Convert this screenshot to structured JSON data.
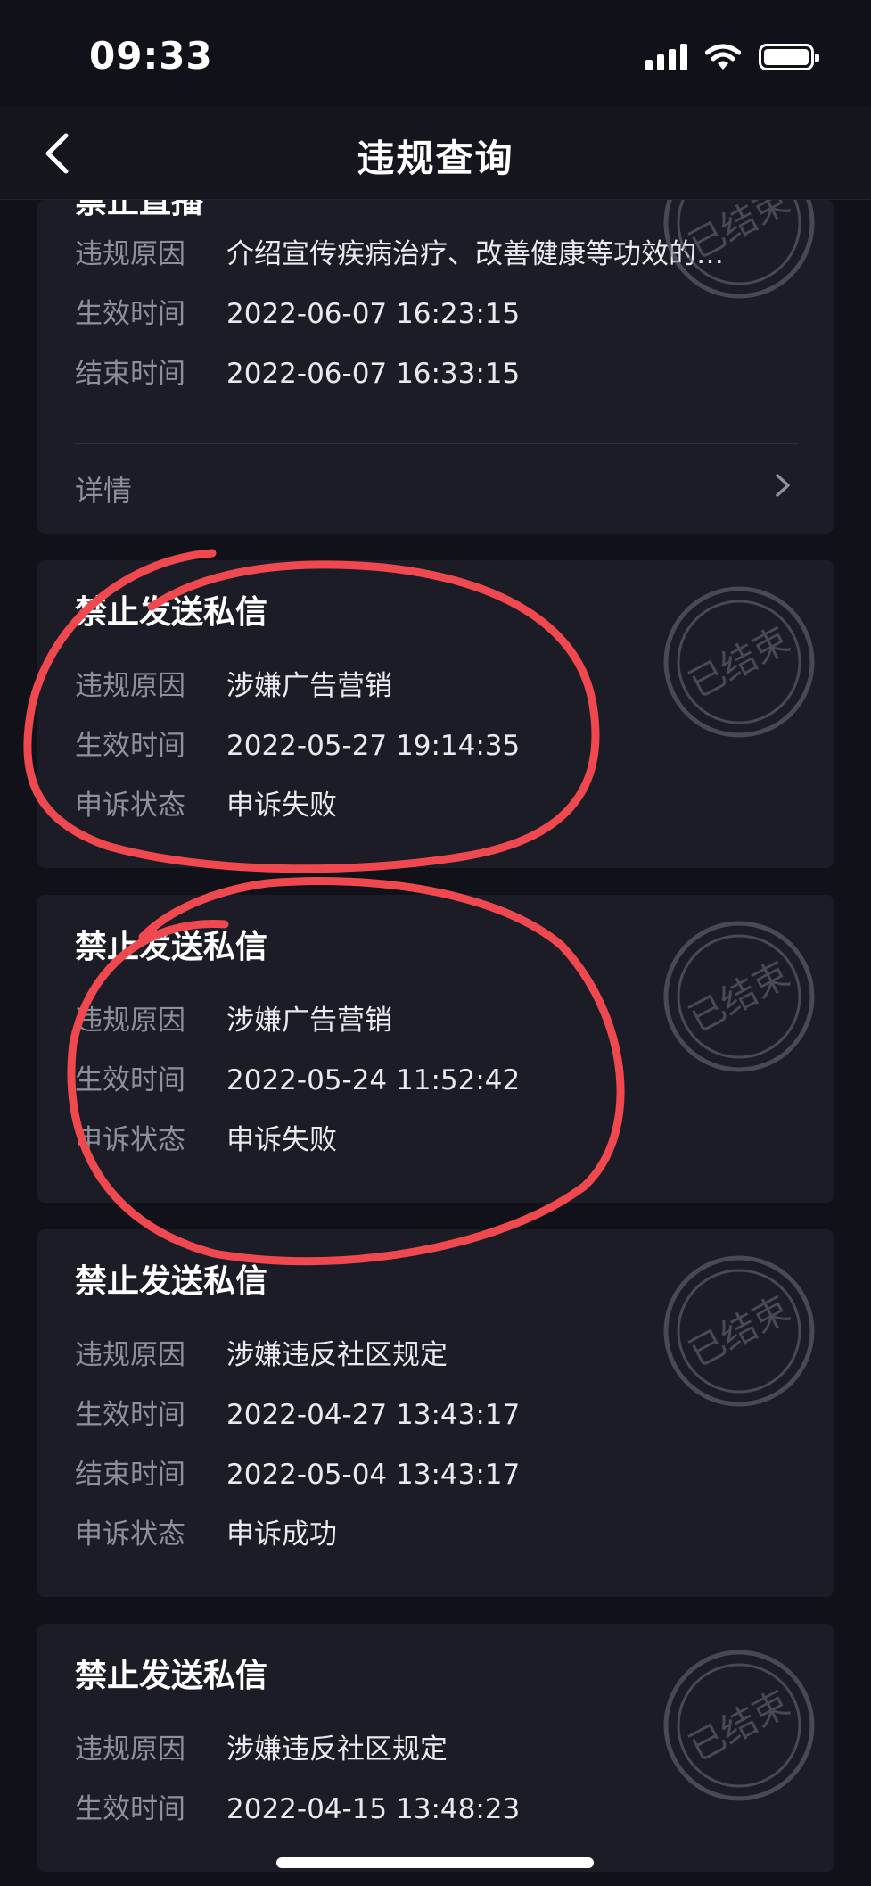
{
  "status_bar": {
    "time": "09:33"
  },
  "nav": {
    "title": "违规查询"
  },
  "labels": {
    "reason": "违规原因",
    "effective": "生效时间",
    "end": "结束时间",
    "appeal": "申诉状态",
    "details": "详情"
  },
  "stamp_text": "已结束",
  "records": [
    {
      "title": "禁止直播",
      "reason": "介绍宣传疾病治疗、改善健康等功效的…",
      "effective": "2022-06-07 16:23:15",
      "end": "2022-06-07 16:33:15"
    },
    {
      "title": "禁止发送私信",
      "reason": "涉嫌广告营销",
      "effective": "2022-05-27 19:14:35",
      "appeal": "申诉失败"
    },
    {
      "title": "禁止发送私信",
      "reason": "涉嫌广告营销",
      "effective": "2022-05-24 11:52:42",
      "appeal": "申诉失败"
    },
    {
      "title": "禁止发送私信",
      "reason": "涉嫌违反社区规定",
      "effective": "2022-04-27 13:43:17",
      "end": "2022-05-04 13:43:17",
      "appeal": "申诉成功"
    },
    {
      "title": "禁止发送私信",
      "reason": "涉嫌违反社区规定",
      "effective": "2022-04-15 13:48:23"
    }
  ],
  "colors": {
    "background": "#111219",
    "card": "#1b1c26",
    "annotation": "#f0484f"
  }
}
